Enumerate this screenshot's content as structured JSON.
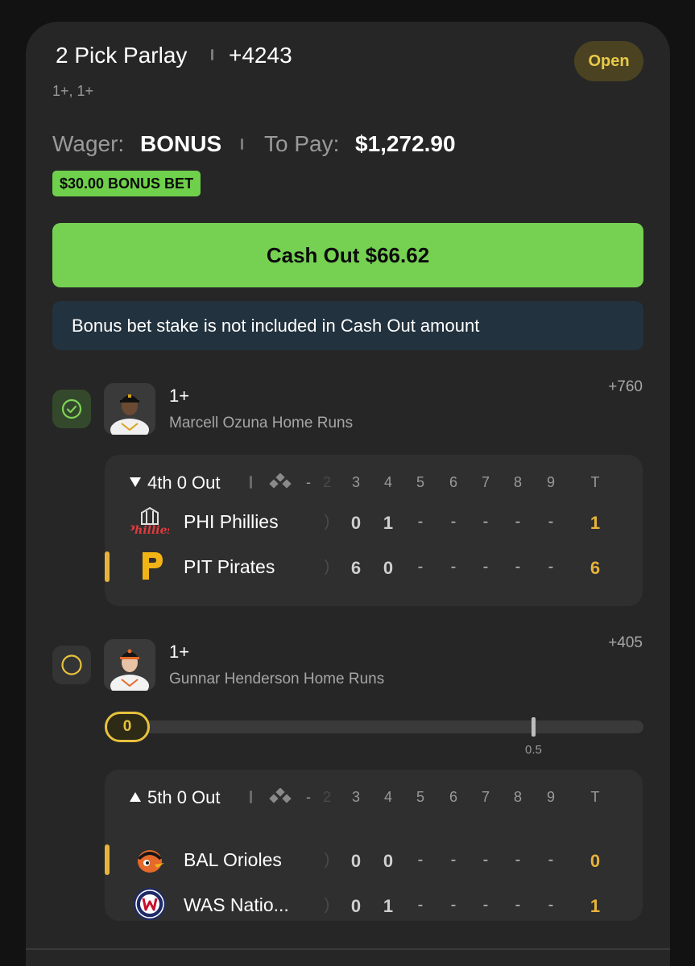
{
  "bet": {
    "title": "2 Pick Parlay",
    "odds": "+4243",
    "subtitle": "1+, 1+",
    "status": "Open",
    "wager_label": "Wager:",
    "wager_value": "BONUS",
    "to_pay_label": "To Pay:",
    "to_pay_value": "$1,272.90",
    "bonus_chip": "$30.00 BONUS BET",
    "cashout_label": "Cash Out $66.62",
    "notice": "Bonus bet stake is not included in Cash Out amount"
  },
  "picks": [
    {
      "line": "1+",
      "description": "Marcell Ozuna Home Runs",
      "odds": "+760",
      "status": "won",
      "status_icon": "check-circle-icon",
      "game": {
        "inning": "4th 0 Out",
        "inning_direction": "bottom",
        "columns": [
          "2",
          "3",
          "4",
          "5",
          "6",
          "7",
          "8",
          "9",
          "T"
        ],
        "teams": [
          {
            "name": "PHI Phillies",
            "logo": "phillies-logo",
            "scores": [
              "0",
              "1",
              "-",
              "-",
              "-",
              "-",
              "-"
            ],
            "total": "1",
            "selected": false
          },
          {
            "name": "PIT Pirates",
            "logo": "pirates-logo",
            "scores": [
              "6",
              "0",
              "-",
              "-",
              "-",
              "-",
              "-"
            ],
            "total": "6",
            "selected": true
          }
        ]
      }
    },
    {
      "line": "1+",
      "description": "Gunnar Henderson Home Runs",
      "odds": "+405",
      "status": "pending",
      "status_icon": "empty-circle-icon",
      "progress": {
        "current": "0",
        "target_label": "0.5",
        "current_value": 0,
        "target_value": 0.5
      },
      "game": {
        "inning": "5th 0 Out",
        "inning_direction": "top",
        "columns": [
          "2",
          "3",
          "4",
          "5",
          "6",
          "7",
          "8",
          "9",
          "T"
        ],
        "teams": [
          {
            "name": "BAL Orioles",
            "logo": "orioles-logo",
            "scores": [
              "0",
              "0",
              "-",
              "-",
              "-",
              "-",
              "-"
            ],
            "total": "0",
            "selected": true
          },
          {
            "name": "WAS Natio...",
            "logo": "nationals-logo",
            "scores": [
              "0",
              "1",
              "-",
              "-",
              "-",
              "-",
              "-"
            ],
            "total": "1",
            "selected": false
          }
        ]
      }
    }
  ],
  "colors": {
    "accent_green": "#76d153",
    "status_yellow": "#e9c948",
    "total_gold": "#e7b33b",
    "card_bg": "#262626",
    "notice_bg": "#22323e"
  }
}
